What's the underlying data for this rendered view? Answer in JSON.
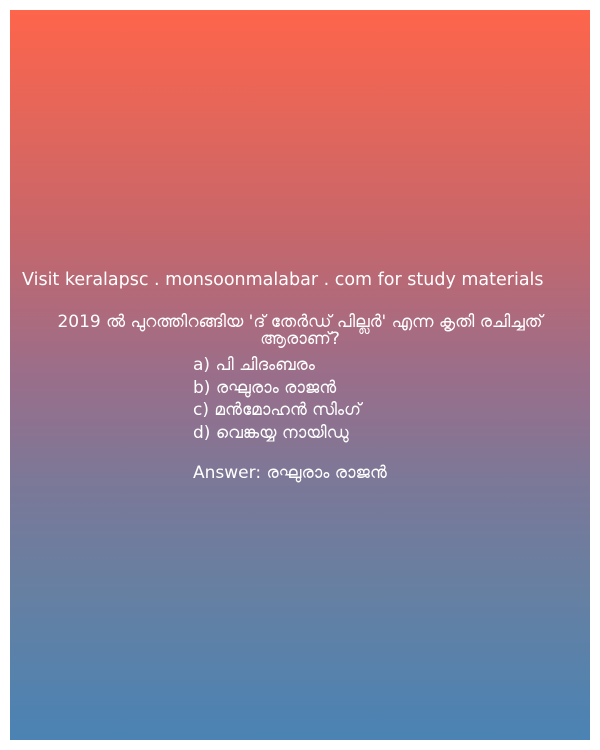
{
  "site_line": "Visit keralapsc . monsoonmalabar . com for study materials",
  "question": {
    "line1": "2019 ൽ പുറത്തിറങ്ങിയ 'ദ് തേർഡ് പില്ലർ' എന്ന കൃതി രചിച്ചത്",
    "line2": "ആരാണ്?"
  },
  "options": [
    "a) പി ചിദംബരം",
    "b) രഘുരാം രാജൻ",
    "c) മൻമോഹൻ സിംഗ്",
    "d) വെങ്കയ്യ നായിഡു"
  ],
  "answer": "Answer: രഘുരാം രാജൻ",
  "colors": {
    "gradient_top": "#fe654b",
    "gradient_bottom": "#4a83b4",
    "text": "#ffffff"
  }
}
